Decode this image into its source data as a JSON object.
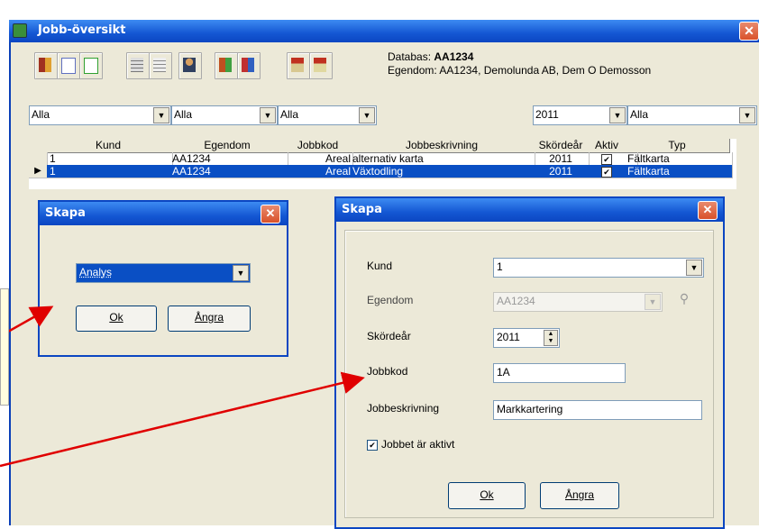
{
  "window": {
    "title": "Jobb-översikt"
  },
  "info": {
    "db_label": "Databas:",
    "db_value": "AA1234",
    "egendom_line": "Egendom: AA1234, Demolunda AB, Dem O Demosson"
  },
  "filters": {
    "f1": "Alla",
    "f2": "Alla",
    "f3": "Alla",
    "year": "2011",
    "f5": "Alla"
  },
  "grid": {
    "columns": [
      "Kund",
      "Egendom",
      "Jobbkod",
      "Jobbeskrivning",
      "Skördeår",
      "Aktiv",
      "Typ"
    ],
    "rows": [
      {
        "kund": "1",
        "egendom": "AA1234",
        "jobbkod": "Areal",
        "beskr": "alternativ karta",
        "ar": "2011",
        "aktiv": "✔",
        "typ": "Fältkarta"
      },
      {
        "kund": "1",
        "egendom": "AA1234",
        "jobbkod": "Areal",
        "beskr": "Växtodling",
        "ar": "2011",
        "aktiv": "✔",
        "typ": "Fältkarta"
      }
    ]
  },
  "dialog_small": {
    "title": "Skapa",
    "select_value": "Analys",
    "ok": "Ok",
    "cancel": "Ångra"
  },
  "dialog_large": {
    "title": "Skapa",
    "kund_label": "Kund",
    "kund_value": "1",
    "egendom_label": "Egendom",
    "egendom_value": "AA1234",
    "ar_label": "Skördeår",
    "ar_value": "2011",
    "kod_label": "Jobbkod",
    "kod_value": "1A",
    "beskr_label": "Jobbeskrivning",
    "beskr_value": "Markkartering",
    "aktiv_label": "Jobbet är aktivt",
    "ok": "Ok",
    "cancel": "Ångra"
  },
  "colors": {
    "accent": "#0b46c2",
    "arrow": "#e00000",
    "selection": "#0a4fc4"
  }
}
